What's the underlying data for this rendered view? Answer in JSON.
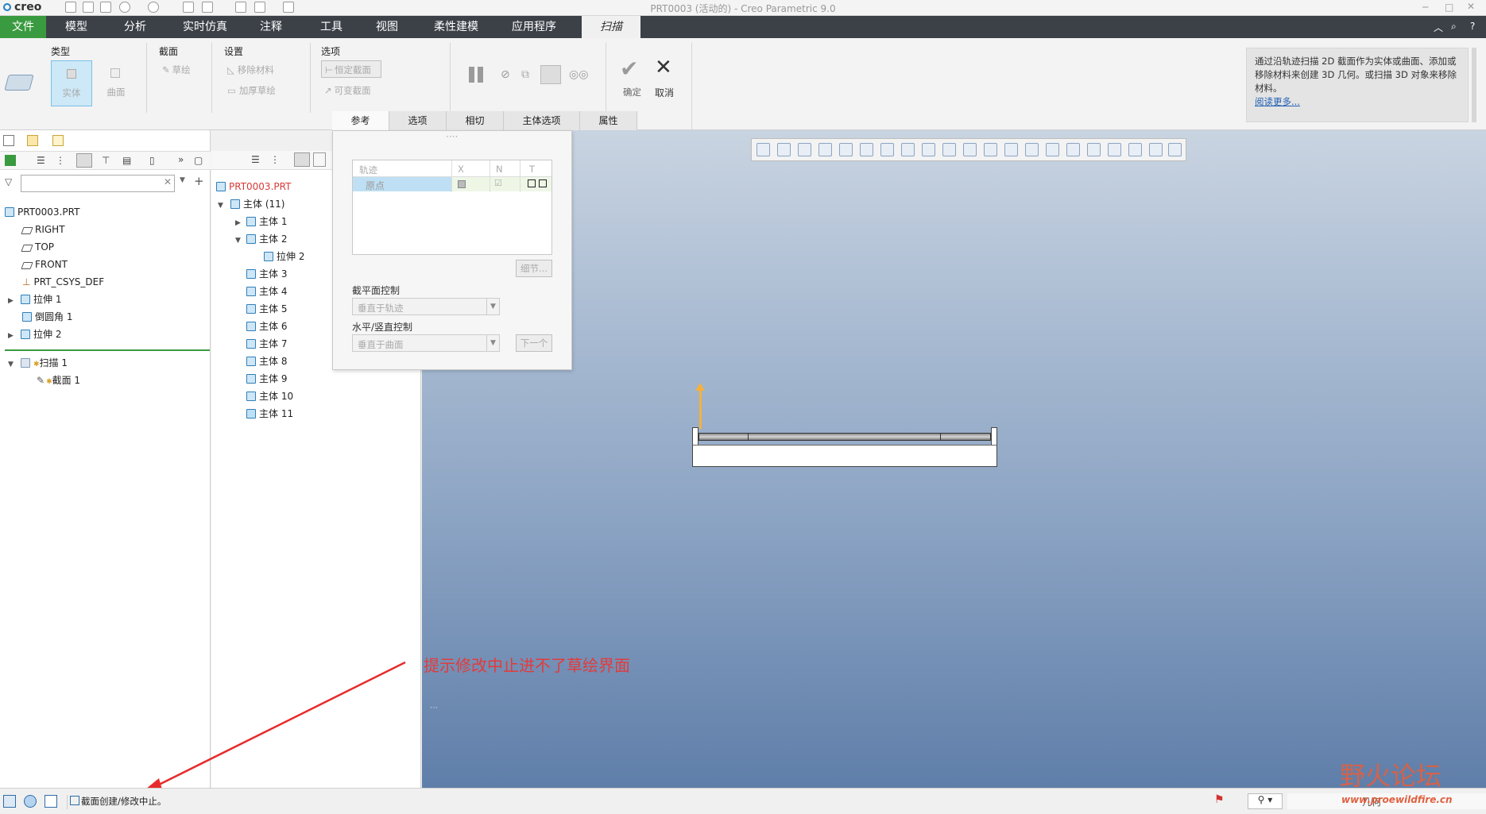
{
  "window": {
    "app_name": "creo",
    "title": "PRT0003 (活动的) - Creo Parametric 9.0"
  },
  "menu": {
    "tabs": [
      "文件",
      "模型",
      "分析",
      "实时仿真",
      "注释",
      "工具",
      "视图",
      "柔性建模",
      "应用程序",
      "扫描"
    ]
  },
  "ribbon": {
    "type_group": {
      "label": "类型",
      "solid": "实体",
      "surface": "曲面"
    },
    "section_group": {
      "label": "截面",
      "sketch": "草绘"
    },
    "settings_group": {
      "label": "设置",
      "remove_material": "移除材料",
      "thicken_sketch": "加厚草绘"
    },
    "options_group": {
      "label": "选项",
      "constant_section": "恒定截面",
      "variable_section": "可变截面"
    },
    "confirm": "确定",
    "cancel": "取消",
    "subtabs": [
      "参考",
      "选项",
      "相切",
      "主体选项",
      "属性"
    ],
    "help_text": "通过沿轨迹扫描 2D 截面作为实体或曲面、添加或移除材料来创建 3D 几何。或扫描 3D 对象来移除材料。",
    "help_link": "阅读更多..."
  },
  "model_tree": {
    "search_placeholder": "",
    "items": [
      {
        "label": "PRT0003.PRT"
      },
      {
        "label": "RIGHT"
      },
      {
        "label": "TOP"
      },
      {
        "label": "FRONT"
      },
      {
        "label": "PRT_CSYS_DEF"
      },
      {
        "label": "拉伸 1"
      },
      {
        "label": "倒圆角 1"
      },
      {
        "label": "拉伸 2"
      },
      {
        "label": "扫描 1"
      },
      {
        "label": "截面 1"
      }
    ]
  },
  "body_tree": {
    "root": "PRT0003.PRT",
    "group": "主体 (11)",
    "items": [
      "主体 1",
      "主体 2",
      "拉伸 2",
      "主体 3",
      "主体 4",
      "主体 5",
      "主体 6",
      "主体 7",
      "主体 8",
      "主体 9",
      "主体 10",
      "主体 11"
    ]
  },
  "ref_panel": {
    "col_trajectory": "轨迹",
    "col_x": "X",
    "col_n": "N",
    "col_t": "T",
    "row_origin": "原点",
    "details": "细节...",
    "section_plane_label": "截平面控制",
    "section_plane_value": "垂直于轨迹",
    "hv_label": "水平/竖直控制",
    "hv_value": "垂直于曲面",
    "next": "下一个"
  },
  "annotation": "提示修改中止进不了草绘界面",
  "status": {
    "message": "截面创建/修改中止。",
    "watermark_a": "野火论坛",
    "watermark_b": "www.proewildfire.cn",
    "filter": "几何"
  },
  "colors": {
    "menu_bg": "#3c4148",
    "file_tab": "#3a9a3f",
    "annotation": "#e23b3b",
    "viewport_top": "#c9d4e1",
    "viewport_bottom": "#5f7ea9"
  }
}
